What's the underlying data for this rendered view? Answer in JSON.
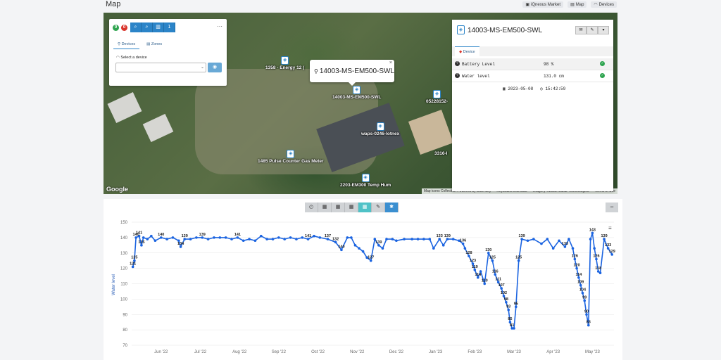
{
  "header": {
    "title": "Map",
    "links": [
      {
        "label": "iQnexus Market",
        "icon": "store-icon"
      },
      {
        "label": "Map",
        "icon": "map-icon"
      },
      {
        "label": "Devices",
        "icon": "wifi-icon"
      }
    ]
  },
  "map": {
    "google_label": "Google",
    "footer": [
      "Map icons Collection Powered by Dark Sky",
      "Keyboard shortcuts",
      "Imagery ©2023 Maxar Technologies",
      "Terms of Use"
    ],
    "markers": [
      {
        "label": "1358 - Energy 12 (",
        "name": "marker-1358"
      },
      {
        "label": "14003-MS-EM500-SWL",
        "name": "marker-14003"
      },
      {
        "label": "05228152-",
        "name": "marker-05228152"
      },
      {
        "label": "waps-0246-lotnex",
        "name": "marker-waps-0246"
      },
      {
        "label": "3316-I",
        "name": "marker-3316"
      },
      {
        "label": "1485 Pulse Counter Gas Meter",
        "name": "marker-1485"
      },
      {
        "label": "2203-EM300 Temp Hum",
        "name": "marker-2203"
      }
    ],
    "popup": {
      "title": "14003-MS-EM500-SWL",
      "close": "×"
    }
  },
  "controls": {
    "badge_green": "0",
    "badge_red": "0",
    "tool_count": "1",
    "menu": "···",
    "tabs": [
      "Devices",
      "Zones"
    ],
    "select_label": "Select a device",
    "select_value": ""
  },
  "device": {
    "title": "14003-MS-EM500-SWL",
    "tab": "Device",
    "rows": [
      {
        "key": "Battery Level",
        "value": "98 %"
      },
      {
        "key": "Water level",
        "value": "131.0 cm"
      }
    ],
    "date": "2023-05-08",
    "time": "15:42:59"
  },
  "chart_toolbar": {
    "collapse": "−"
  },
  "chart_data": {
    "type": "line",
    "ylabel": "Water level",
    "ylim": [
      70,
      150
    ],
    "yticks": [
      70,
      80,
      90,
      100,
      110,
      120,
      130,
      140,
      150
    ],
    "x_ticks": [
      "Jun '22",
      "Jul '22",
      "Aug '22",
      "Sep '22",
      "Oct '22",
      "Nov '22",
      "Dec '22",
      "Jan '23",
      "Feb '23",
      "Mar '23",
      "Apr '23",
      "May '23"
    ],
    "x_range_months": [
      -0.75,
      11.55
    ],
    "series": [
      {
        "color": "#1a63e0",
        "points": [
          [
            -0.72,
            121
          ],
          [
            -0.68,
            125
          ],
          [
            -0.64,
            140
          ],
          [
            -0.56,
            141
          ],
          [
            -0.5,
            135
          ],
          [
            -0.45,
            140
          ],
          [
            -0.35,
            139
          ],
          [
            -0.25,
            141
          ],
          [
            -0.15,
            138
          ],
          [
            0,
            140
          ],
          [
            0.15,
            139
          ],
          [
            0.3,
            140
          ],
          [
            0.45,
            138
          ],
          [
            0.5,
            134
          ],
          [
            0.6,
            139
          ],
          [
            0.75,
            139
          ],
          [
            0.9,
            140
          ],
          [
            1.05,
            140
          ],
          [
            1.2,
            139
          ],
          [
            1.35,
            140
          ],
          [
            1.5,
            140
          ],
          [
            1.65,
            140
          ],
          [
            1.8,
            139
          ],
          [
            1.95,
            140
          ],
          [
            2.1,
            138
          ],
          [
            2.25,
            139
          ],
          [
            2.4,
            138
          ],
          [
            2.55,
            141
          ],
          [
            2.7,
            139
          ],
          [
            2.85,
            139
          ],
          [
            3.0,
            140
          ],
          [
            3.15,
            139
          ],
          [
            3.3,
            140
          ],
          [
            3.45,
            139
          ],
          [
            3.6,
            140
          ],
          [
            3.75,
            139
          ],
          [
            3.9,
            141
          ],
          [
            4.05,
            140
          ],
          [
            4.25,
            139
          ],
          [
            4.45,
            137
          ],
          [
            4.6,
            132
          ],
          [
            4.75,
            140
          ],
          [
            4.85,
            140
          ],
          [
            4.95,
            135
          ],
          [
            5.05,
            133
          ],
          [
            5.15,
            131
          ],
          [
            5.25,
            127
          ],
          [
            5.35,
            125
          ],
          [
            5.45,
            139
          ],
          [
            5.55,
            135
          ],
          [
            5.65,
            133
          ],
          [
            5.75,
            139
          ],
          [
            5.9,
            139
          ],
          [
            6.0,
            138
          ],
          [
            6.2,
            139
          ],
          [
            6.4,
            139
          ],
          [
            6.55,
            139
          ],
          [
            6.7,
            139
          ],
          [
            6.85,
            139
          ],
          [
            6.95,
            133
          ],
          [
            7.1,
            139
          ],
          [
            7.2,
            135
          ],
          [
            7.3,
            139
          ],
          [
            7.45,
            139
          ],
          [
            7.6,
            138
          ],
          [
            7.7,
            136
          ],
          [
            7.75,
            133
          ],
          [
            7.85,
            128
          ],
          [
            7.95,
            123
          ],
          [
            8.0,
            119
          ],
          [
            8.08,
            114
          ],
          [
            8.15,
            118
          ],
          [
            8.25,
            110
          ],
          [
            8.35,
            130
          ],
          [
            8.45,
            125
          ],
          [
            8.52,
            116
          ],
          [
            8.6,
            111
          ],
          [
            8.68,
            107
          ],
          [
            8.74,
            102
          ],
          [
            8.8,
            98
          ],
          [
            8.86,
            93
          ],
          [
            8.9,
            85
          ],
          [
            8.95,
            81
          ],
          [
            9.0,
            81
          ],
          [
            9.05,
            95
          ],
          [
            9.12,
            125
          ],
          [
            9.2,
            139
          ],
          [
            9.35,
            138
          ],
          [
            9.5,
            139
          ],
          [
            9.7,
            136
          ],
          [
            9.85,
            139
          ],
          [
            10.0,
            133
          ],
          [
            10.15,
            138
          ],
          [
            10.3,
            134
          ],
          [
            10.4,
            139
          ],
          [
            10.5,
            133
          ],
          [
            10.55,
            126
          ],
          [
            10.6,
            120
          ],
          [
            10.65,
            114
          ],
          [
            10.7,
            109
          ],
          [
            10.75,
            104
          ],
          [
            10.8,
            99
          ],
          [
            10.85,
            90
          ],
          [
            10.9,
            83
          ],
          [
            10.95,
            139
          ],
          [
            11.0,
            143
          ],
          [
            11.05,
            133
          ],
          [
            11.1,
            126
          ],
          [
            11.15,
            118
          ],
          [
            11.2,
            117
          ],
          [
            11.3,
            139
          ],
          [
            11.4,
            133
          ],
          [
            11.5,
            129
          ]
        ],
        "labels": [
          {
            "i": 0,
            "t": "121"
          },
          {
            "i": 1,
            "t": "125"
          },
          {
            "i": 2,
            "t": "140"
          },
          {
            "i": 3,
            "t": "141"
          },
          {
            "i": 4,
            "t": "135"
          },
          {
            "i": 9,
            "t": "140"
          },
          {
            "i": 13,
            "t": "134"
          },
          {
            "i": 14,
            "t": "139"
          },
          {
            "i": 17,
            "t": "139"
          },
          {
            "i": 23,
            "t": "141"
          },
          {
            "i": 35,
            "t": "141"
          },
          {
            "i": 38,
            "t": "137"
          },
          {
            "i": 39,
            "t": "132"
          },
          {
            "i": 40,
            "t": "140"
          },
          {
            "i": 47,
            "t": "127"
          },
          {
            "i": 49,
            "t": "139"
          },
          {
            "i": 60,
            "t": "133"
          },
          {
            "i": 62,
            "t": "139"
          },
          {
            "i": 65,
            "t": "136"
          },
          {
            "i": 67,
            "t": "128"
          },
          {
            "i": 68,
            "t": "123"
          },
          {
            "i": 69,
            "t": "119"
          },
          {
            "i": 70,
            "t": "114"
          },
          {
            "i": 72,
            "t": "110"
          },
          {
            "i": 73,
            "t": "130"
          },
          {
            "i": 74,
            "t": "125"
          },
          {
            "i": 75,
            "t": "116"
          },
          {
            "i": 76,
            "t": "111"
          },
          {
            "i": 77,
            "t": "107"
          },
          {
            "i": 78,
            "t": "102"
          },
          {
            "i": 79,
            "t": "98"
          },
          {
            "i": 80,
            "t": "93"
          },
          {
            "i": 81,
            "t": "85"
          },
          {
            "i": 82,
            "t": "81"
          },
          {
            "i": 84,
            "t": "95"
          },
          {
            "i": 85,
            "t": "125"
          },
          {
            "i": 86,
            "t": "139"
          },
          {
            "i": 93,
            "t": "133"
          },
          {
            "i": 96,
            "t": "126"
          },
          {
            "i": 97,
            "t": "120"
          },
          {
            "i": 98,
            "t": "114"
          },
          {
            "i": 99,
            "t": "109"
          },
          {
            "i": 100,
            "t": "104"
          },
          {
            "i": 101,
            "t": "99"
          },
          {
            "i": 102,
            "t": "90"
          },
          {
            "i": 103,
            "t": "83"
          },
          {
            "i": 105,
            "t": "143"
          },
          {
            "i": 107,
            "t": "126"
          },
          {
            "i": 108,
            "t": "118"
          },
          {
            "i": 110,
            "t": "139"
          },
          {
            "i": 111,
            "t": "133"
          },
          {
            "i": 112,
            "t": "129"
          }
        ]
      }
    ]
  }
}
